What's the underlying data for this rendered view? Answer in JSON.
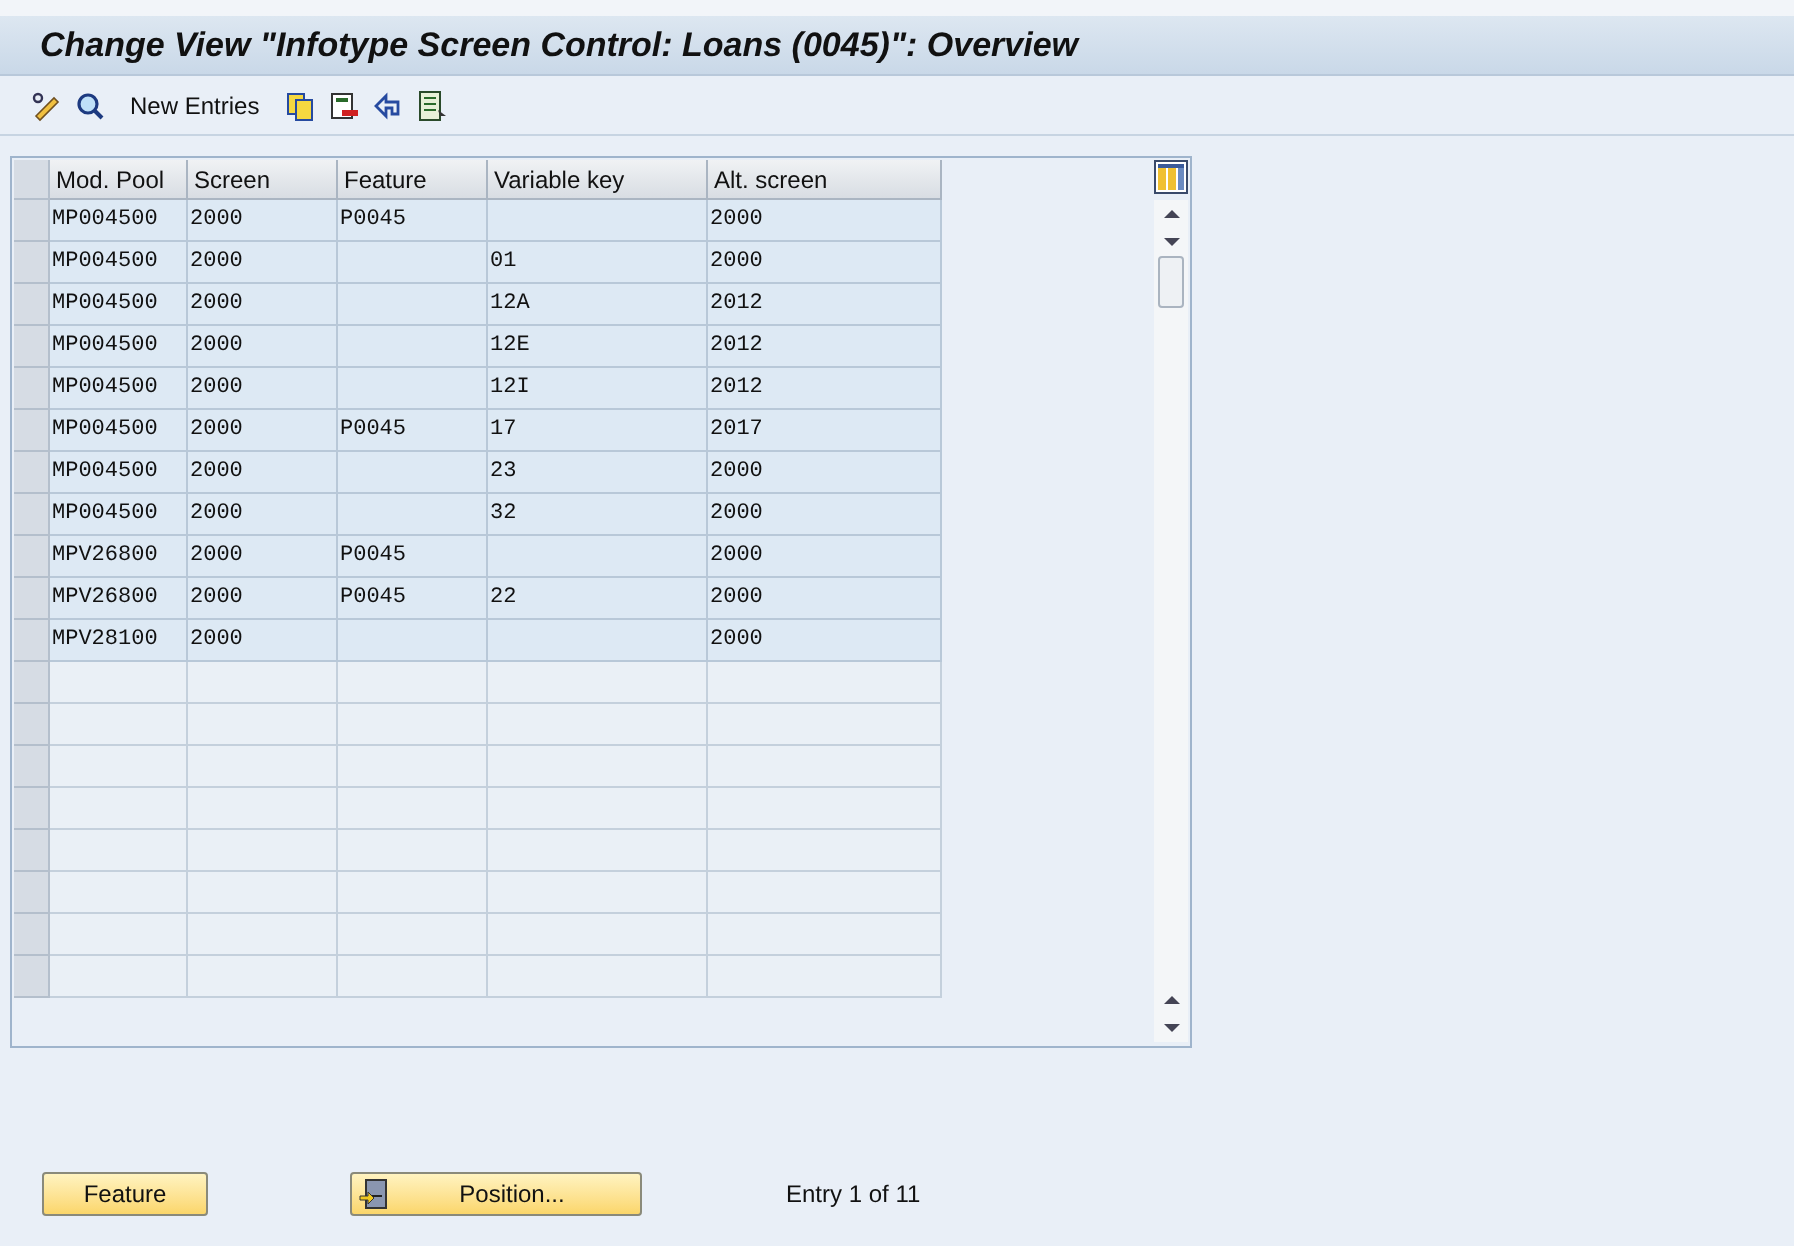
{
  "window": {
    "title": "Change View \"Infotype Screen Control: Loans (0045)\": Overview"
  },
  "toolbar": {
    "new_entries": "New Entries"
  },
  "table": {
    "columns": [
      "Mod. Pool",
      "Screen",
      "Feature",
      "Variable key",
      "Alt. screen"
    ],
    "rows": [
      [
        "MP004500",
        "2000",
        "P0045",
        "",
        "2000"
      ],
      [
        "MP004500",
        "2000",
        "",
        "01",
        "2000"
      ],
      [
        "MP004500",
        "2000",
        "",
        "12A",
        "2012"
      ],
      [
        "MP004500",
        "2000",
        "",
        "12E",
        "2012"
      ],
      [
        "MP004500",
        "2000",
        "",
        "12I",
        "2012"
      ],
      [
        "MP004500",
        "2000",
        "P0045",
        "17",
        "2017"
      ],
      [
        "MP004500",
        "2000",
        "",
        "23",
        "2000"
      ],
      [
        "MP004500",
        "2000",
        "",
        "32",
        "2000"
      ],
      [
        "MPV26800",
        "2000",
        "P0045",
        "",
        "2000"
      ],
      [
        "MPV26800",
        "2000",
        "P0045",
        "22",
        "2000"
      ],
      [
        "MPV28100",
        "2000",
        "",
        "",
        "2000"
      ]
    ]
  },
  "buttons": {
    "feature": "Feature",
    "position": "Position..."
  },
  "status": "Entry 1 of 11"
}
